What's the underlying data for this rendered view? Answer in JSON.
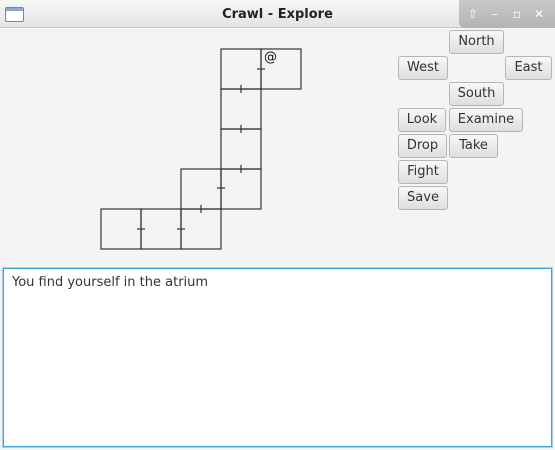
{
  "window": {
    "title": "Crawl - Explore",
    "icons": [
      "app-window-icon",
      "restore-icon",
      "minimize-icon",
      "maximize-icon",
      "close-icon"
    ]
  },
  "map": {
    "player_glyph": "@"
  },
  "controls": {
    "north": "North",
    "west": "West",
    "east": "East",
    "south": "South",
    "look": "Look",
    "examine": "Examine",
    "drop": "Drop",
    "take": "Take",
    "fight": "Fight",
    "save": "Save"
  },
  "log": {
    "text": "You find yourself in the atrium"
  }
}
